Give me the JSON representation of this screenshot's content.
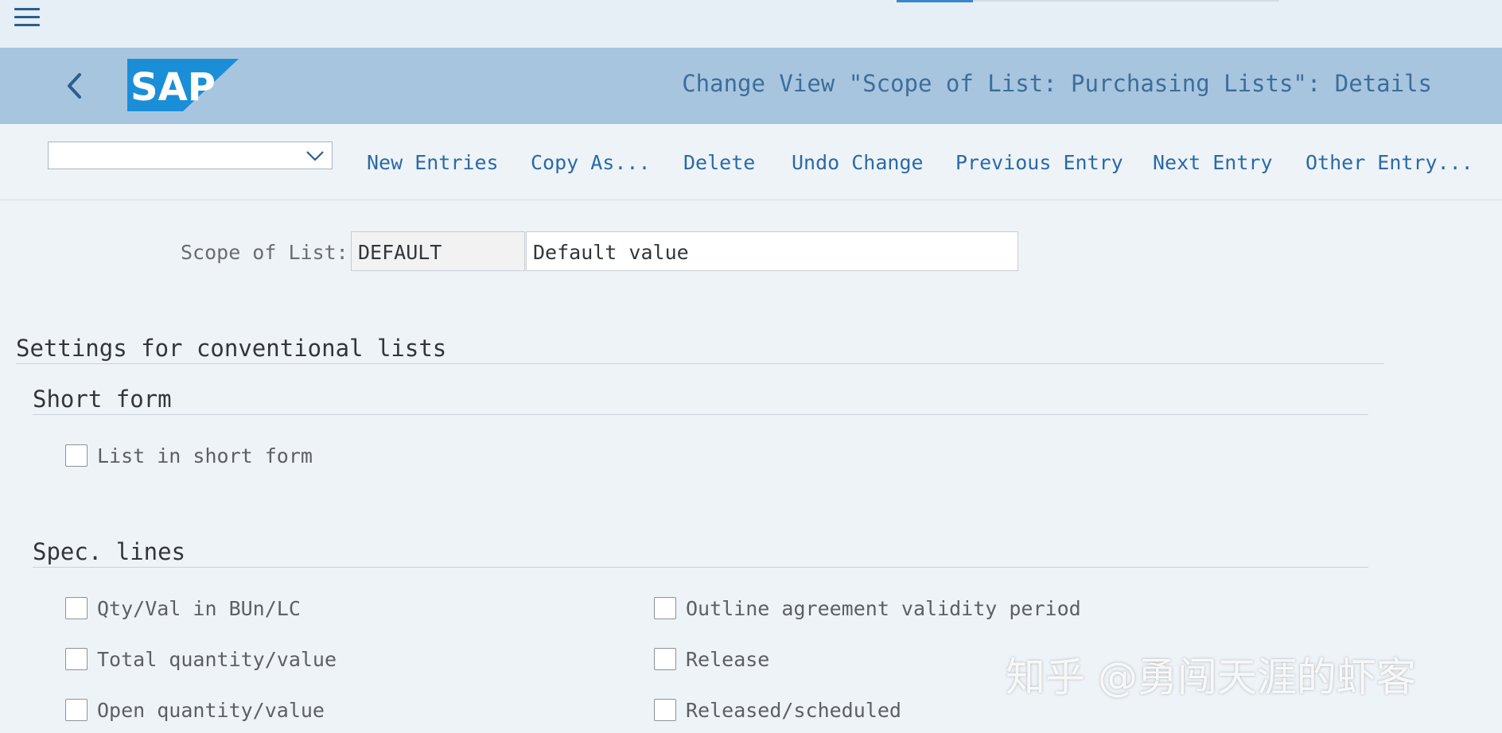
{
  "header": {
    "title": "Change View \"Scope of List: Purchasing Lists\": Details",
    "logo_text": "SAP"
  },
  "toolbar": {
    "dropdown_value": "",
    "buttons": [
      "New Entries",
      "Copy As...",
      "Delete",
      "Undo Change",
      "Previous Entry",
      "Next Entry",
      "Other Entry..."
    ]
  },
  "form": {
    "scope_label": "Scope of List:",
    "scope_key": "DEFAULT",
    "scope_desc": "Default value"
  },
  "sections": {
    "main_title": "Settings for conventional lists",
    "short_form": {
      "title": "Short form",
      "items": [
        {
          "label": "List in short form",
          "checked": false
        }
      ]
    },
    "spec_lines": {
      "title": "Spec. lines",
      "left": [
        {
          "label": "Qty/Val in BUn/LC",
          "checked": false
        },
        {
          "label": "Total quantity/value",
          "checked": false
        },
        {
          "label": "Open quantity/value",
          "checked": false
        }
      ],
      "right": [
        {
          "label": "Outline agreement validity period",
          "checked": false
        },
        {
          "label": "Release",
          "checked": false
        },
        {
          "label": "Released/scheduled",
          "checked": false
        }
      ]
    }
  },
  "watermark": "知乎 @勇闯天涯的虾客",
  "colors": {
    "shell_bar": "#a8c5df",
    "logo": "#1b8ed8",
    "action_text": "#2b6aa5",
    "background": "#eef3f8"
  }
}
